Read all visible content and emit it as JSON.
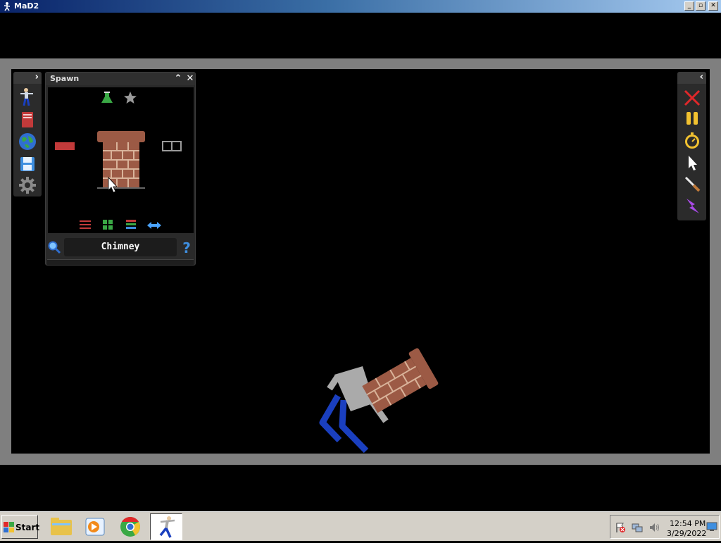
{
  "window": {
    "title": "MaD2"
  },
  "spawn_panel": {
    "title": "Spawn",
    "selected_item": "Chimney"
  },
  "taskbar": {
    "start_label": "Start",
    "clock_time": "12:54 PM",
    "clock_date": "3/29/2022"
  },
  "colors": {
    "brick": "#9c5a45",
    "mortar": "#d9b39a",
    "ragdoll_body": "#aaaaaa",
    "ragdoll_legs": "#1a3fbf",
    "accent_blue": "#4aa3ff"
  },
  "icons": {
    "left_strip": [
      "ragdoll-icon",
      "book-icon",
      "globe-icon",
      "floppy-save-icon",
      "gear-icon"
    ],
    "right_strip": [
      "close-x-icon",
      "pause-icon",
      "stopwatch-icon",
      "cursor-icon",
      "knife-icon",
      "lightning-icon"
    ]
  }
}
